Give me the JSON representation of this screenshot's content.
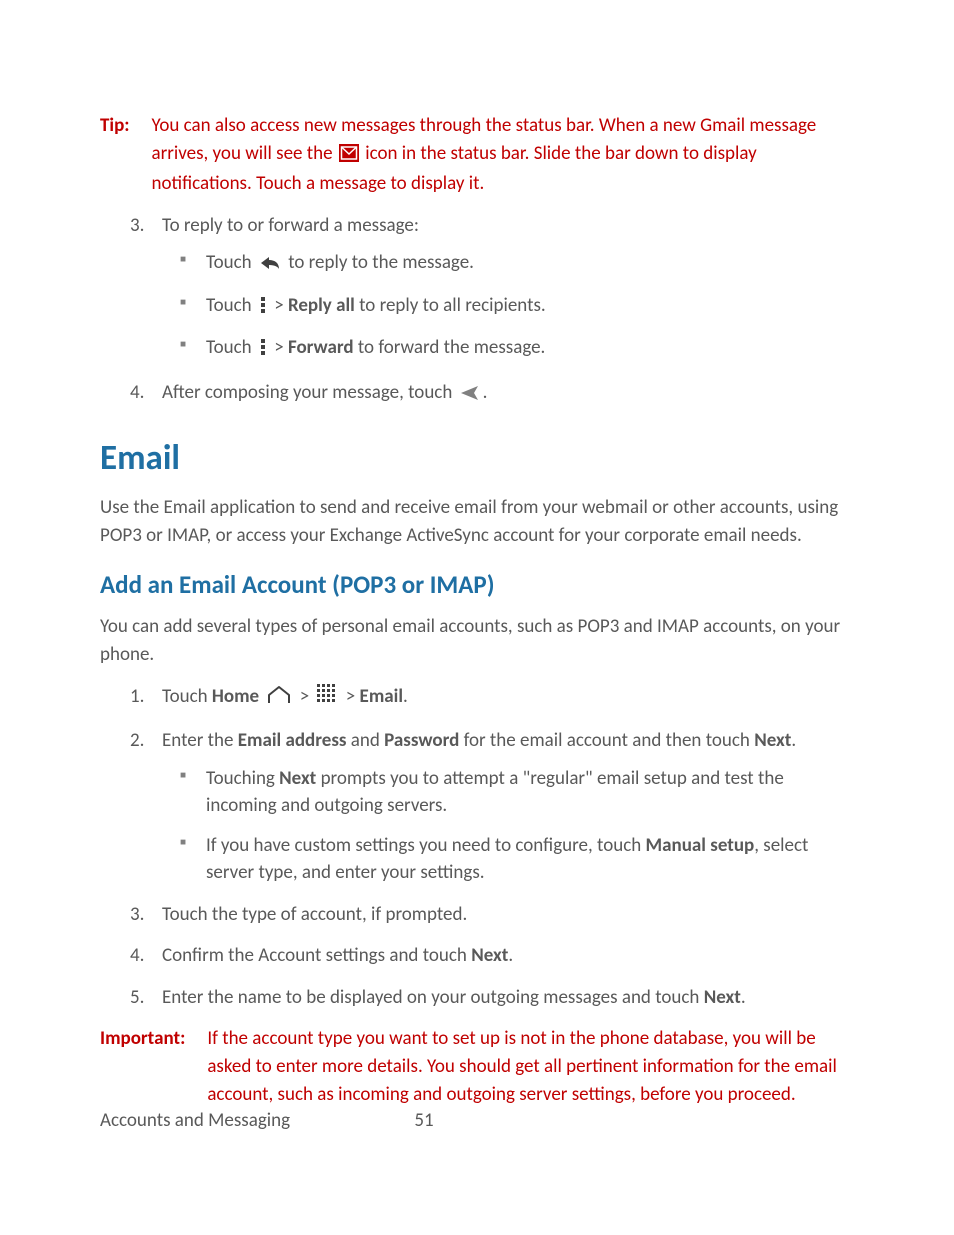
{
  "tip": {
    "label": "Tip:",
    "body_a": "You can also access new messages through the status bar. When a new Gmail message arrives, you will see the ",
    "body_b": " icon in the status bar. Slide the bar down to display notifications. Touch a message to display it."
  },
  "steps_a": {
    "s3": {
      "text": "To reply to or forward a message:",
      "bul1_a": "Touch ",
      "bul1_b": " to reply to the message.",
      "bul2_a": "Touch ",
      "bul2_b": " > ",
      "bul2_bold": "Reply all",
      "bul2_c": " to reply to all recipients.",
      "bul3_a": "Touch ",
      "bul3_b": " > ",
      "bul3_bold": "Forward",
      "bul3_c": " to forward the message."
    },
    "s4_a": "After composing your message, touch ",
    "s4_b": "."
  },
  "email": {
    "h1": "Email",
    "intro": "Use the Email application to send and receive email from your webmail or other accounts, using POP3 or IMAP, or access your Exchange ActiveSync account for your corporate email needs."
  },
  "add": {
    "h2": "Add an Email Account (POP3 or IMAP)",
    "intro": "You can add several types of personal email accounts, such as POP3 and IMAP accounts, on your phone.",
    "s1_a": "Touch ",
    "s1_home": "Home",
    "s1_b": " > ",
    "s1_c": " > ",
    "s1_email": "Email",
    "s1_d": ".",
    "s2_a": "Enter the ",
    "s2_email_addr": "Email address",
    "s2_b": " and ",
    "s2_password": "Password",
    "s2_c": " for the email account and then touch ",
    "s2_next": "Next",
    "s2_d": ".",
    "s2_bul1_a": "Touching ",
    "s2_bul1_next": "Next",
    "s2_bul1_b": " prompts you to attempt a \"regular\" email setup and test the incoming and outgoing servers.",
    "s2_bul2_a": "If you have custom settings you need to configure, touch ",
    "s2_bul2_manual": "Manual setup",
    "s2_bul2_b": ", select server type, and enter your settings.",
    "s3": "Touch the type of account, if prompted.",
    "s4_a": "Confirm the Account settings and touch ",
    "s4_next": "Next",
    "s4_b": ".",
    "s5_a": "Enter the name to be displayed on your outgoing messages and touch ",
    "s5_next": "Next",
    "s5_b": "."
  },
  "important": {
    "label": "Important:",
    "body": "If the account type you want to set up is not in the phone database, you will be asked to enter more details. You should get all pertinent information for the email account, such as incoming and outgoing server settings, before you proceed."
  },
  "footer": {
    "section": "Accounts and Messaging",
    "page": "51"
  }
}
